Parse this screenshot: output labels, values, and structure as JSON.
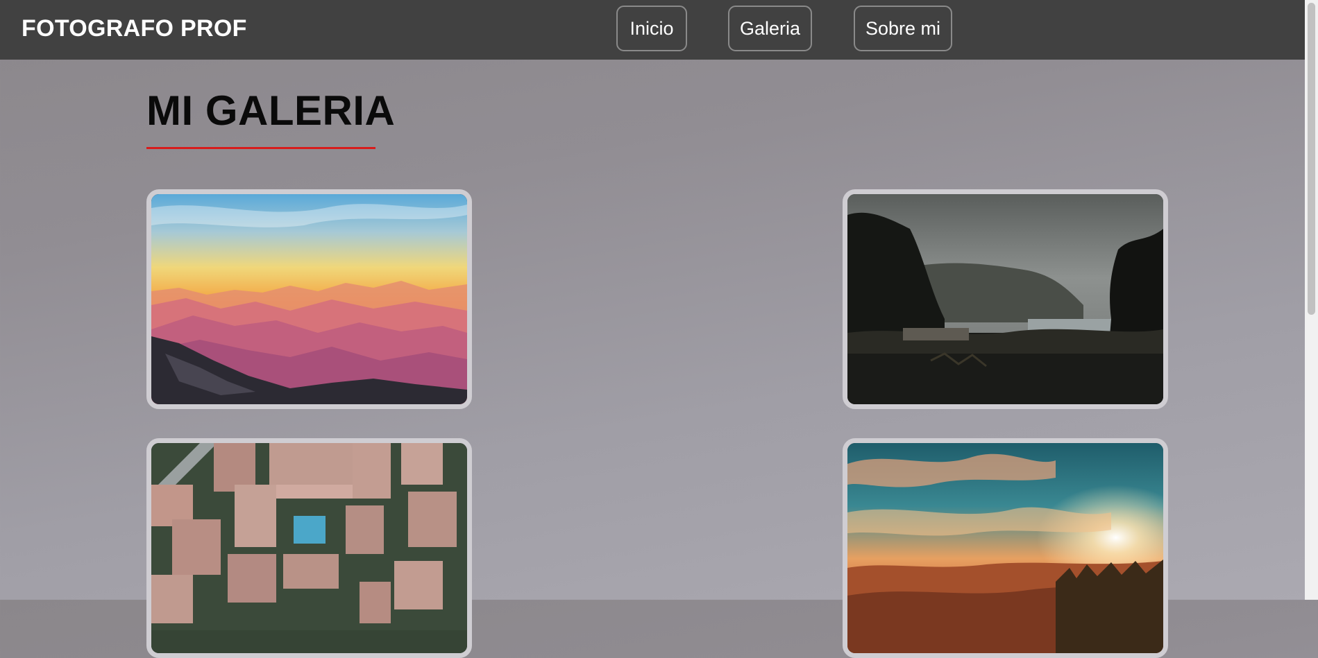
{
  "header": {
    "brand": "FOTOGRAFO PROF",
    "nav": [
      {
        "label": "Inicio"
      },
      {
        "label": "Galeria"
      },
      {
        "label": "Sobre mi"
      }
    ]
  },
  "main": {
    "title": "MI GALERIA"
  },
  "colors": {
    "header_bg": "#414141",
    "accent_underline": "#d81c1c",
    "card_border": "#cfcdd2"
  },
  "gallery": [
    {
      "subject": "mountain sunset"
    },
    {
      "subject": "misty lake with cabin"
    },
    {
      "subject": "aerial view of buildings and pool"
    },
    {
      "subject": "sunset over hills"
    }
  ]
}
